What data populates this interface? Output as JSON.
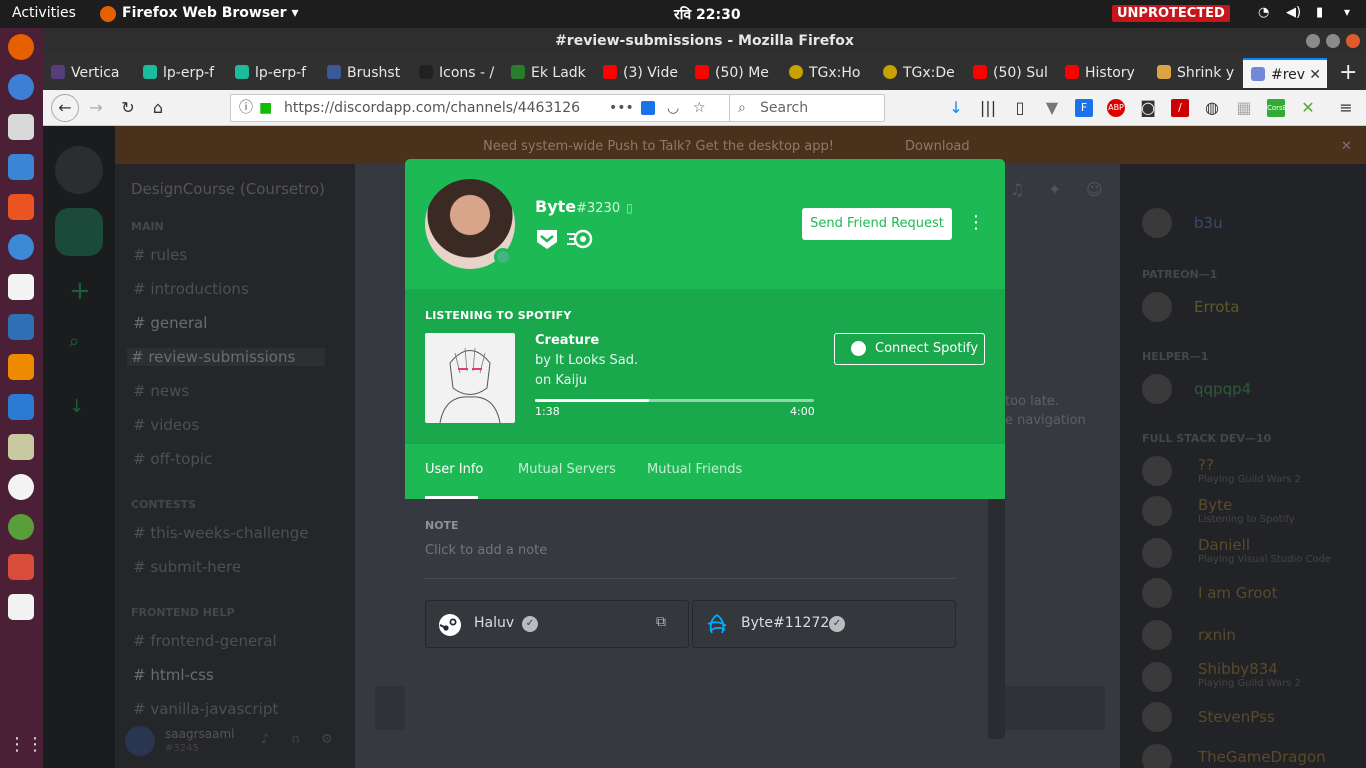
{
  "os": {
    "activities": "Activities",
    "app_menu": "Firefox Web Browser ▾",
    "clock": "रवि 22:30",
    "vpn_status": "UNPROTECTED"
  },
  "window": {
    "title": "#review-submissions - Mozilla Firefox"
  },
  "browser": {
    "tabs": [
      {
        "label": "Vertica",
        "color": "#563d7c"
      },
      {
        "label": "lp-erp-f",
        "color": "#1abc9c"
      },
      {
        "label": "lp-erp-f",
        "color": "#1abc9c"
      },
      {
        "label": "Brushst",
        "color": "#3b5998"
      },
      {
        "label": "Icons - /",
        "color": "#222222"
      },
      {
        "label": "Ek Ladk",
        "color": "#2a7d2a"
      },
      {
        "label": "(3) Vide",
        "color": "#ff0000"
      },
      {
        "label": "(50) Me",
        "color": "#ff0000"
      },
      {
        "label": "TGx:Ho",
        "color": "#c8a200"
      },
      {
        "label": "TGx:De",
        "color": "#c8a200"
      },
      {
        "label": "(50) Sul",
        "color": "#ff0000"
      },
      {
        "label": "History",
        "color": "#ff0000"
      },
      {
        "label": "Shrink y",
        "color": "#d9a441"
      },
      {
        "label": "#rev",
        "color": "#7289da"
      }
    ],
    "url": "https://discordapp.com/channels/4463126",
    "search_placeholder": "Search"
  },
  "discord": {
    "banner_text": "Need system-wide Push to Talk? Get the desktop app!",
    "banner_download": "Download",
    "server_name": "DesignCourse (Coursetro)",
    "categories": {
      "main": "MAIN",
      "contests": "CONTESTS",
      "frontend": "FRONTEND HELP"
    },
    "channels": {
      "rules": "rules",
      "introductions": "introductions",
      "general": "general",
      "review": "review-submissions",
      "news": "news",
      "videos": "videos",
      "offtopic": "off-topic",
      "challenge": "this-weeks-challenge",
      "submit": "submit-here",
      "frontend_general": "frontend-general",
      "htmlcss": "html-css",
      "vanilla": "vanilla-javascript"
    },
    "me": {
      "name": "saagrsaaml",
      "tag": "#3245"
    },
    "chat_fragments": {
      "line1": "too late.",
      "line2": "e navigation"
    },
    "members": {
      "m1": "b3u",
      "patreon_header": "PATREON—1",
      "errota": "Errota",
      "helper_header": "HELPER—1",
      "helper": "qqpqp4",
      "fullstack_header": "FULL STACK DEV—10",
      "q": "??",
      "q_act": "Playing Guild Wars 2",
      "byte": "Byte",
      "byte_act": "Listening to Spotify",
      "daniell": "Daniell",
      "daniell_act": "Playing Visual Studio Code",
      "groot": "I am Groot",
      "rxnin": "rxnin",
      "shibby": "Shibby834",
      "shibby_act": "Playing Guild Wars 2",
      "steven": "StevenPss",
      "dragon": "TheGameDragon"
    }
  },
  "profile": {
    "username": "Byte",
    "discriminator": "#3230",
    "send_friend_request": "Send Friend Request",
    "listening_header": "LISTENING TO SPOTIFY",
    "song": "Creature",
    "artist_line": "by It Looks Sad.",
    "album_line": "on Kaiju",
    "time_current": "1:38",
    "time_total": "4:00",
    "progress_fraction": 0.41,
    "connect_spotify": "Connect Spotify",
    "tabs": {
      "user_info": "User Info",
      "mutual_servers": "Mutual Servers",
      "mutual_friends": "Mutual Friends"
    },
    "note_label": "NOTE",
    "note_placeholder": "Click to add a note",
    "accounts": {
      "steam": "Haluv",
      "battlenet": "Byte#11272"
    },
    "colors": {
      "spotify_green": "#1db954",
      "online": "#43b581"
    }
  }
}
